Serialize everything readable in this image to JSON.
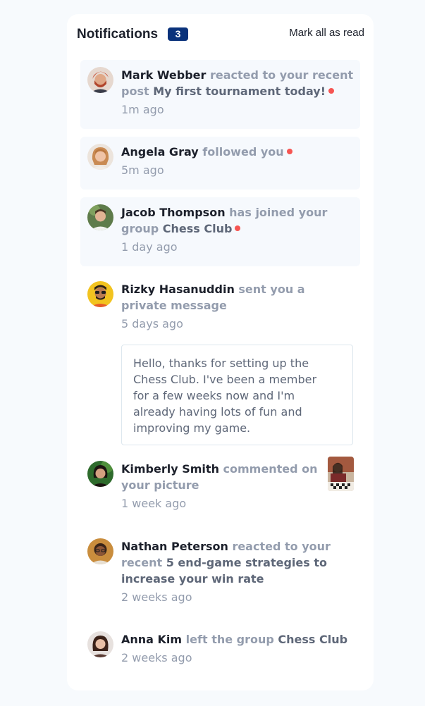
{
  "header": {
    "title": "Notifications",
    "unread_count": "3",
    "mark_all_label": "Mark all as read"
  },
  "colors": {
    "accent": "#0a327b",
    "unread_dot": "#f65552",
    "unread_bg": "#f6f9fd",
    "page_bg": "#f7fafd"
  },
  "notifications": [
    {
      "actor": "Mark Webber",
      "action_line1": "reacted to your recent",
      "action_line2": "post",
      "target": "My first tournament today!",
      "time": "1m ago",
      "unread": true
    },
    {
      "actor": "Angela Gray",
      "action": "followed you",
      "time": "5m ago",
      "unread": true
    },
    {
      "actor": "Jacob Thompson",
      "action_line1": "has joined your",
      "action_line2": "group",
      "target": "Chess Club",
      "time": "1 day ago",
      "unread": true
    },
    {
      "actor": "Rizky Hasanuddin",
      "action_line1": "sent you a private",
      "action_line2": "message",
      "time": "5 days ago",
      "message": [
        "Hello, thanks for setting up the",
        "Chess Club. I've been a member",
        "for a few weeks now and I'm",
        "already having lots of fun and",
        "improving my game."
      ],
      "unread": false
    },
    {
      "actor": "Kimberly Smith",
      "action_line1": "commented on",
      "action_line2": "your picture",
      "time": "1 week ago",
      "unread": false
    },
    {
      "actor": "Nathan Peterson",
      "action_line1": "reacted to your",
      "action_line2": "recent",
      "target_line1": "5 end-game strategies to",
      "target_line2": "increase your win rate",
      "time": "2 weeks ago",
      "unread": false
    },
    {
      "actor": "Anna Kim",
      "action": "left the group",
      "target": "Chess Club",
      "time": "2 weeks ago",
      "unread": false
    }
  ]
}
